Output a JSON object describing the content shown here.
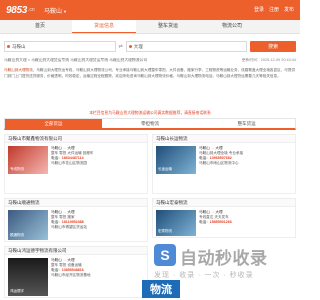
{
  "header": {
    "logo": "9853",
    "logo_suffix": ".cn",
    "city": "马鞍山",
    "city_caret": "▼",
    "links": [
      "登录",
      "注册",
      "发布"
    ]
  },
  "nav": {
    "tabs": [
      "首页",
      "货运信息",
      "整车货运",
      "物流公司"
    ]
  },
  "search": {
    "from_value": "马鞍山",
    "to_value": "大理",
    "button_label": "搜索"
  },
  "crumbs": {
    "left": "马鞍山到大理 > 马鞍山到大理货运专线 马鞍山到大理货运专线 马鞍山到大理物流公司",
    "right": "更新时间：2025-12-09 20:43:44"
  },
  "description": {
    "lead": "马鞍山到大理物流",
    "body": "，马鞍山到大理货运专线，马鞍山到大理物流公司，专业承接马鞍山到大理整车零担、大件设备、搬家行李、工程物资等运输业务，线路覆盖大理全境各县区，可提供门到门上门提货送货服务，价格透明，时效稳定，运输过程全程跟踪，欢迎来电咨询马鞍山到大理物流价格，马鞍山到大理物流电话，马鞍山到大理货运需要几天等相关信息。"
  },
  "notice": "本栏目信息为马鞍山到大理物流运输公司真实数据推荐，请直接电话联系",
  "subtabs": [
    "全部货运",
    "零担物流",
    "整车货运"
  ],
  "cards": [
    {
      "title": "马鞍山市聚鑫物流有限公司",
      "thumb_caption": "专线物流",
      "from": "马鞍山",
      "arrow": "→",
      "to": "大理",
      "services": "整车 零担 大件运输 回程车",
      "phone_label": "电话：",
      "phone": "18604487114",
      "address": "马鞍山市花山区物流园"
    },
    {
      "title": "马鞍山长运物流",
      "thumb_caption": "长途运输",
      "from": "马鞍山",
      "arrow": "→",
      "to": "大理",
      "services": "马鞍山到大理全境 专业承接",
      "phone_label": "电话：",
      "phone": "13965507682",
      "address": "马鞍山市雨山区物流中心"
    },
    {
      "title": "马鞍山顺通物流",
      "thumb_caption": "顺通物流",
      "from": "马鞍山",
      "arrow": "→",
      "to": "大理",
      "services": "整车 零担 搬家",
      "phone_label": "电话：",
      "phone": "18119952388",
      "address": "马鞍山市博望区货运站"
    },
    {
      "title": "马鞍山宏泰物流",
      "thumb_caption": "宏泰物流",
      "from": "马鞍山",
      "arrow": "→",
      "to": "大理",
      "services": "专线直达 天天发车",
      "phone_label": "电话：",
      "phone": "15855501266",
      "address": "马鞍山市当涂县物流园"
    },
    {
      "title": "马鞍山鸿运德宇物流有限公司",
      "thumb_caption": "鸿运德宇",
      "from": "马鞍山",
      "arrow": "→",
      "to": "大理",
      "services": "整车 零担 设备运输",
      "phone_label": "电话：",
      "phone": "13855548816",
      "address": "马鞍山市经开区物流基地"
    }
  ],
  "watermark": {
    "logo_glyph": "S",
    "title": "自动秒收录",
    "subtitle": "发现 · 收录 · 一次 · 秒收录",
    "badge": "物流"
  }
}
